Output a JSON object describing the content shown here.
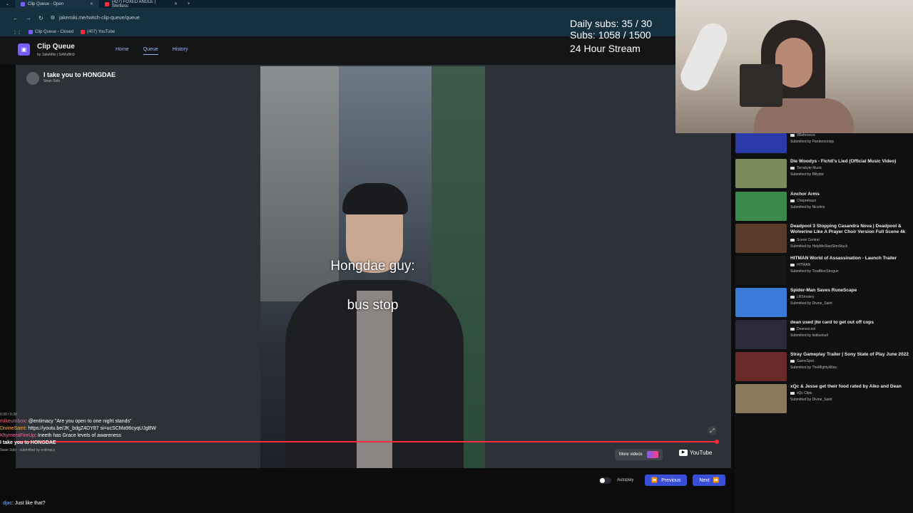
{
  "browser": {
    "tabs": [
      {
        "label": "Clip Queue - Open",
        "active": true
      },
      {
        "label": "(427) FOXED ANGLE | Shirtless",
        "active": false
      }
    ],
    "url": "jakemiki.me/twitch-clip-queue/queue",
    "bookmarks": [
      {
        "label": "Clip Queue - Closed"
      },
      {
        "label": "(407) YouTube"
      }
    ]
  },
  "app": {
    "name": "Clip Queue",
    "by": "by JakeMiki | SirMuffin9",
    "nav": [
      {
        "label": "Home"
      },
      {
        "label": "Queue"
      },
      {
        "label": "History"
      }
    ]
  },
  "overlay": {
    "daily_subs": "Daily subs: 35 / 30",
    "subs": "Subs: 1058 / 1500",
    "stream": "24 Hour Stream"
  },
  "clip": {
    "title": "I take you to HONGDAE",
    "author": "Sean Solo",
    "caption1": "Hongdae guy:",
    "caption2": "bus stop",
    "more_videos": "More videos",
    "source": "YouTube",
    "progress": 0.99
  },
  "controls": {
    "autoplay": "Autoplay",
    "previous": "Previous",
    "next": "Next"
  },
  "chat": {
    "lines": [
      {
        "user": "mikeumbox",
        "text": "@entimacy \"Are you open to one night stands\"",
        "cls": "u1"
      },
      {
        "user": "DivineSaint",
        "text": "https://youtu.be/JK_bdgZ4DY87 si=ucSCMa96cyqUJgBW",
        "cls": "u2"
      },
      {
        "user": "KhymeraFireUp",
        "text": "Ineeth has Grace levels of awareness",
        "cls": "u3"
      },
      {
        "user": "",
        "text": "I take you to HONGDAE",
        "cls": "bold"
      },
      {
        "user": "",
        "text": "Sean Solo · submitted by entimacy",
        "cls": "meta"
      }
    ],
    "timestamp": "0:30 / 0:30",
    "bottom_user": "djac",
    "bottom_text": "Just like that?"
  },
  "queue": [
    {
      "title": "",
      "channel": "9Reference",
      "submitted": "Submitted by Pandemoniqx",
      "color": "#2a3aa8"
    },
    {
      "title": "Die Woodys - Fichtl's Lied (Official Music Video)",
      "channel": "Terrabyte Music",
      "submitted": "Submitted by Billydot",
      "color": "#7a8a5a"
    },
    {
      "title": "Anchor Arms",
      "channel": "Cheprekaun",
      "submitted": "Submitted by Nicolms",
      "color": "#3a8a4a"
    },
    {
      "title": "Deadpool 3 Stopping Casandra Nova | Deadpool & Wolverine Like A Prayer Choir Version Full Scene 4k",
      "channel": "Scene Central",
      "submitted": "Submitted by HelpMeStepSlimStuck",
      "color": "#5a3a2a"
    },
    {
      "title": "HITMAN World of Assassination - Launch Trailer",
      "channel": "HITMAN",
      "submitted": "Submitted by TicalBiscShogun",
      "color": "#151515"
    },
    {
      "title": "Spider-Man Saves RuneScape",
      "channel": "LRSmokey",
      "submitted": "Submitted by Divine_Saint",
      "color": "#3a7ad8"
    },
    {
      "title": "dean used jtw card to get out off cops",
      "channel": "Deansocool",
      "submitted": "Submitted by itsblueball",
      "color": "#2a2a3a"
    },
    {
      "title": "Stray Gameplay Trailer | Sony State of Play June 2022",
      "channel": "GameSpot",
      "submitted": "Submitted by TheMightyAtlas",
      "color": "#6a2a2a"
    },
    {
      "title": "xQc & Jesse get their food rated by Aiko and Dean",
      "channel": "xQc Clips",
      "submitted": "Submitted by Divine_Saint",
      "color": "#8a7a5a"
    }
  ]
}
